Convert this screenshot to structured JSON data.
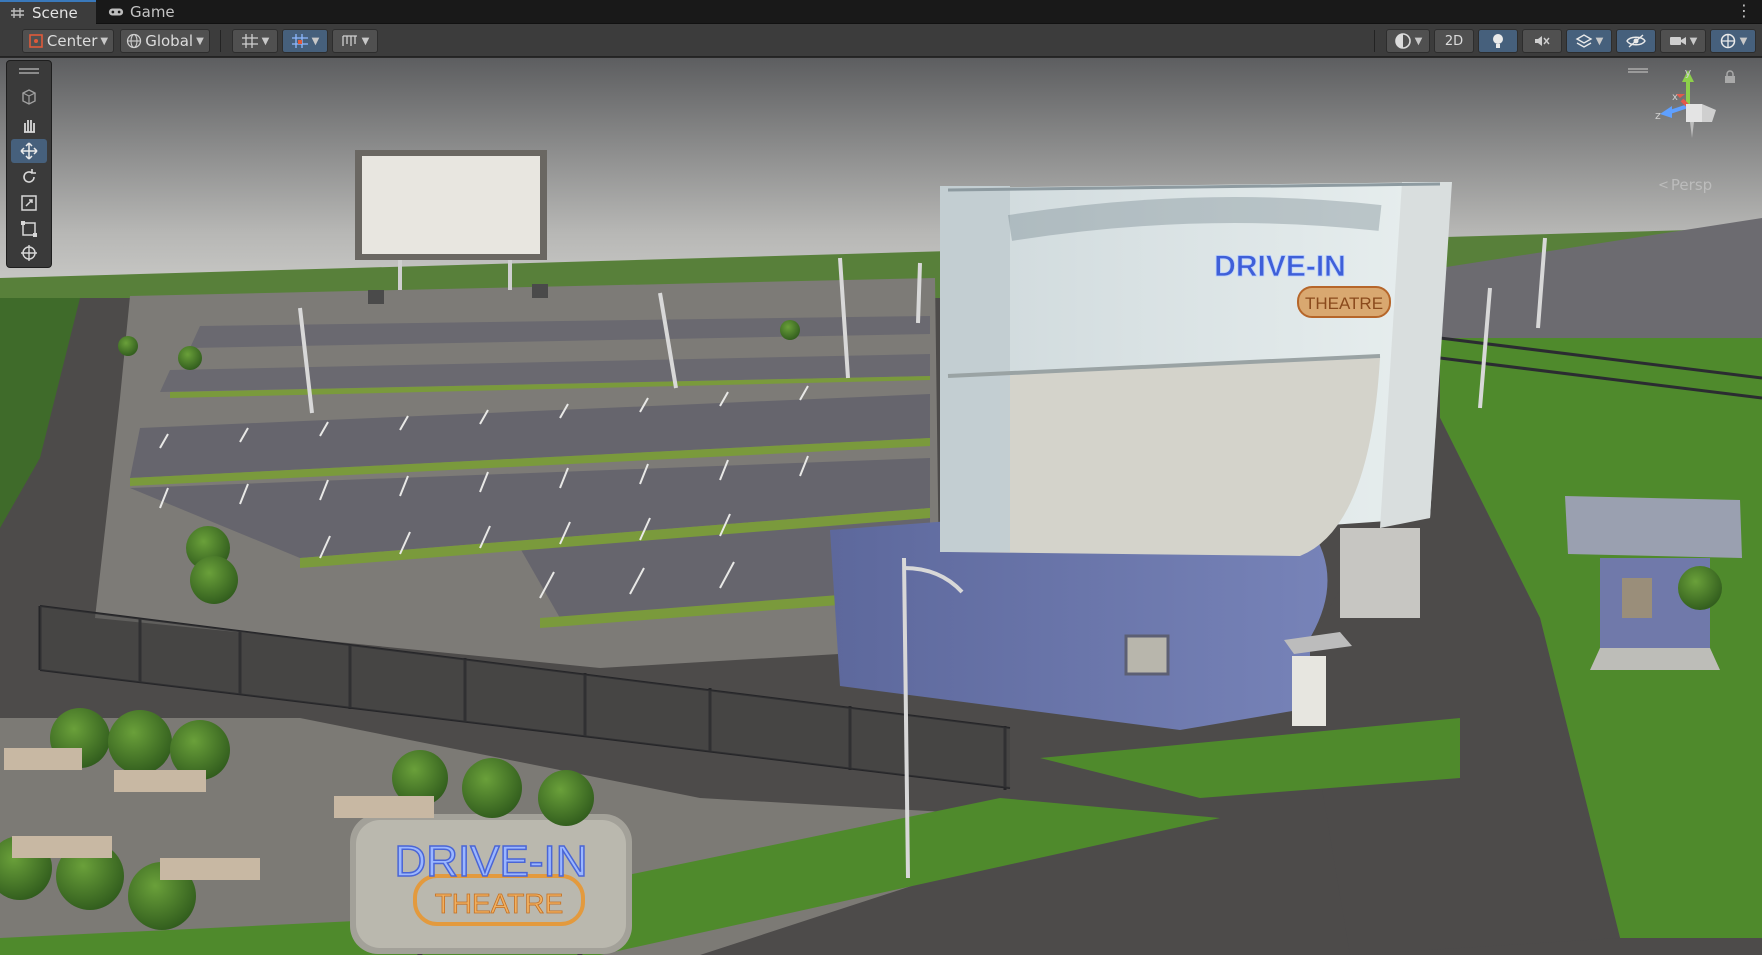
{
  "tabs": [
    {
      "label": "Scene",
      "icon": "hash-grid-icon",
      "active": true
    },
    {
      "label": "Game",
      "icon": "gamepad-icon",
      "active": false
    }
  ],
  "toolbar": {
    "pivot_label": "Center",
    "space_label": "Global",
    "mode_2d_label": "2D"
  },
  "viewport": {
    "projection_label": "Persp",
    "gizmo_axes": {
      "x": "x",
      "y": "y",
      "z": "z"
    },
    "drive_in_big": "DRIVE-IN",
    "theatre_big": "THEATRE",
    "drive_in_small": "DRIVE-IN",
    "theatre_small": "THEATRE"
  },
  "colors": {
    "accent": "#46607c",
    "sign_neon_blue": "#6ea7ff",
    "sign_neon_orange": "#e39a3e",
    "grass": "#4f8a2c",
    "asphalt": "#5c5c62"
  }
}
